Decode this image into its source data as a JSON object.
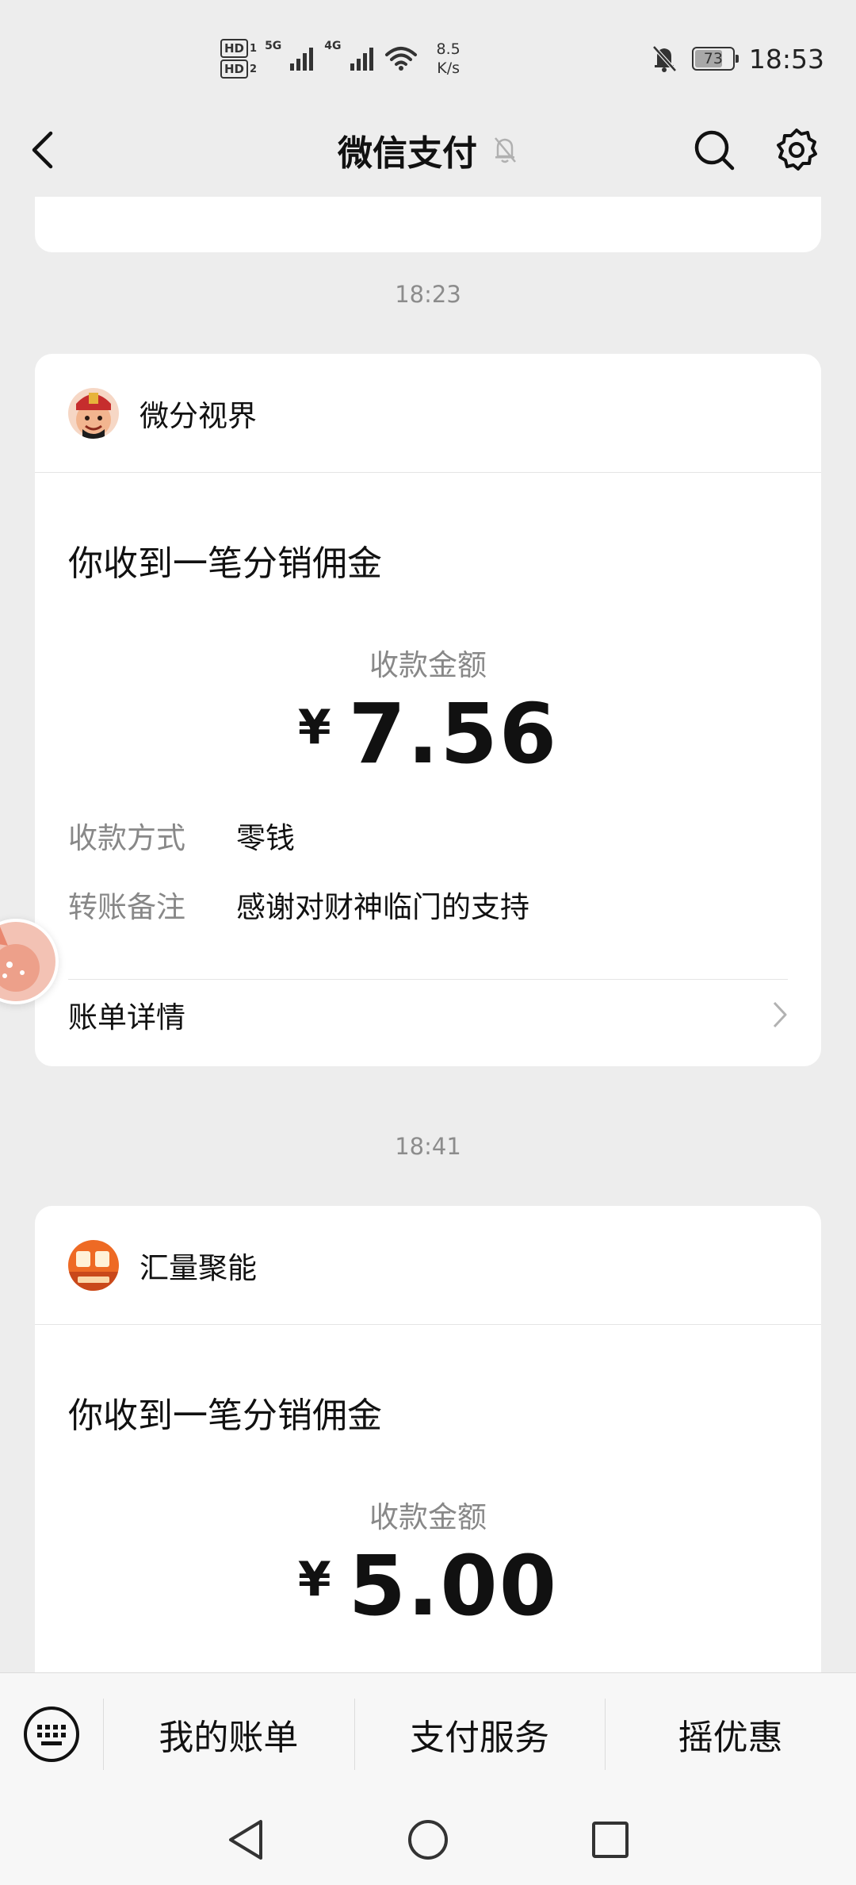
{
  "status_bar": {
    "hd1": "HD",
    "hd1_sub": "1",
    "hd2": "HD",
    "hd2_sub": "2",
    "net1": "5G",
    "net2": "4G",
    "speed_value": "8.5",
    "speed_unit": "K/s",
    "battery": "73",
    "time": "18:53"
  },
  "nav": {
    "title": "微信支付",
    "icons": [
      "back-arrow-icon",
      "bell-muted-icon",
      "search-icon",
      "gear-icon"
    ]
  },
  "messages": [
    {
      "time": "18:23",
      "merchant": "微分视界",
      "title": "你收到一笔分销佣金",
      "amount_label": "收款金额",
      "currency": "¥",
      "amount": "7.56",
      "rows": [
        {
          "key": "收款方式",
          "value": "零钱"
        },
        {
          "key": "转账备注",
          "value": "感谢对财神临门的支持"
        }
      ],
      "detail_label": "账单详情"
    },
    {
      "time": "18:41",
      "merchant": "汇量聚能",
      "title": "你收到一笔分销佣金",
      "amount_label": "收款金额",
      "currency": "¥",
      "amount": "5.00"
    }
  ],
  "bottom_menu": {
    "items": [
      "我的账单",
      "支付服务",
      "摇优惠"
    ]
  },
  "colors": {
    "background": "#ededed",
    "card": "#ffffff",
    "secondary_text": "#888888"
  }
}
